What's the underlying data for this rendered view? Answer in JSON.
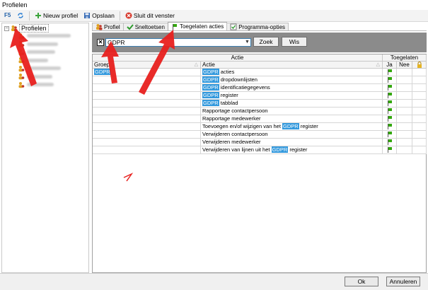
{
  "window": {
    "title": "Profielen"
  },
  "toolbar": {
    "new_profile": "Nieuw profiel",
    "save": "Opslaan",
    "close_window": "Sluit dit venster"
  },
  "tree": {
    "root_label": "Profielen",
    "child_count": 7
  },
  "tabs": [
    {
      "label": "Profiel",
      "icon": "profile-icon"
    },
    {
      "label": "Sneltoetsen",
      "icon": "check-icon"
    },
    {
      "label": "Toegelaten acties",
      "icon": "green-flag-icon"
    },
    {
      "label": "Programma-opties",
      "icon": "checkbox-icon"
    }
  ],
  "filter": {
    "clear_symbol": "✕",
    "search_value": "GDPR",
    "search_button": "Zoek",
    "clear_button": "Wis"
  },
  "grid": {
    "group_header_actie": "Actie",
    "group_header_toegelaten": "Toegelaten",
    "col_groep": "Groep",
    "col_actie": "Actie",
    "col_ja": "Ja",
    "col_nee": "Nee",
    "rows": [
      {
        "groep": "GDPR",
        "actie_hl": "GDPR",
        "actie": " acties",
        "ja": true
      },
      {
        "groep": "",
        "actie_hl": "GDPR",
        "actie": " dropdownlijsten",
        "ja": true
      },
      {
        "groep": "",
        "actie_hl": "GDPR",
        "actie": " identificatiegegevens",
        "ja": true
      },
      {
        "groep": "",
        "actie_hl": "GDPR",
        "actie": " register",
        "ja": true
      },
      {
        "groep": "",
        "actie_hl": "GDPR",
        "actie": " tabblad",
        "ja": true
      },
      {
        "groep": "",
        "actie_pre": "Rapportage contactpersoon",
        "ja": true
      },
      {
        "groep": "",
        "actie_pre": "Rapportage medewerker",
        "ja": true
      },
      {
        "groep": "",
        "actie_pre": "Toevoegen en/of wijzigen van het ",
        "actie_hl": "GDPR",
        "actie": " register",
        "ja": true
      },
      {
        "groep": "",
        "actie_pre": "Verwijderen contactpersoon",
        "ja": true
      },
      {
        "groep": "",
        "actie_pre": "Verwijderen medewerker",
        "ja": true
      },
      {
        "groep": "",
        "actie_pre": "Verwijderen van lijnen uit het ",
        "actie_hl": "GDPR",
        "actie": " register",
        "ja": true
      }
    ]
  },
  "footer": {
    "ok": "Ok",
    "cancel": "Annuleren"
  },
  "colors": {
    "highlight": "#3399dd",
    "flag": "#34a80f",
    "annotation": "#e8201e"
  }
}
